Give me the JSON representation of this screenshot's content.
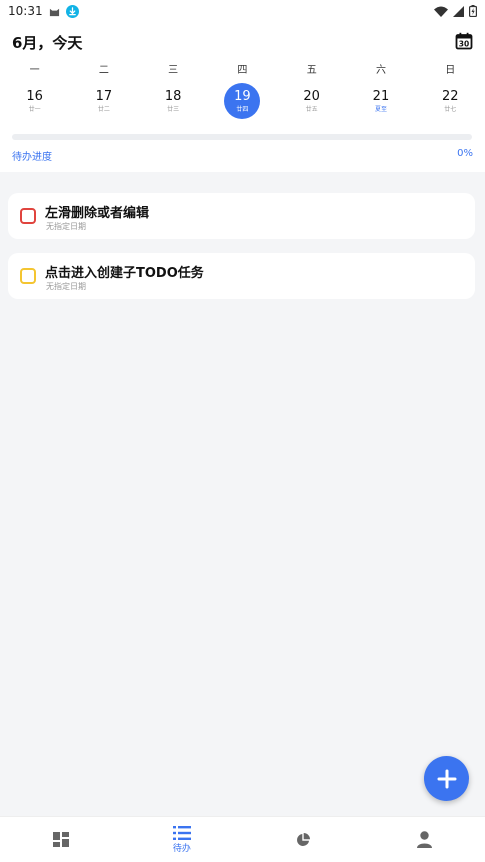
{
  "status_bar": {
    "time": "10:31"
  },
  "header": {
    "title": "6月，今天"
  },
  "calendar": {
    "days": [
      {
        "weekday": "一",
        "date": "16",
        "lunar": "廿一",
        "selected": false,
        "festival": false
      },
      {
        "weekday": "二",
        "date": "17",
        "lunar": "廿二",
        "selected": false,
        "festival": false
      },
      {
        "weekday": "三",
        "date": "18",
        "lunar": "廿三",
        "selected": false,
        "festival": false
      },
      {
        "weekday": "四",
        "date": "19",
        "lunar": "廿四",
        "selected": true,
        "festival": false
      },
      {
        "weekday": "五",
        "date": "20",
        "lunar": "廿五",
        "selected": false,
        "festival": false
      },
      {
        "weekday": "六",
        "date": "21",
        "lunar": "夏至",
        "selected": false,
        "festival": true
      },
      {
        "weekday": "日",
        "date": "22",
        "lunar": "廿七",
        "selected": false,
        "festival": false
      }
    ]
  },
  "progress": {
    "label": "待办进度",
    "value_text": "0%",
    "value": 0
  },
  "tasks": [
    {
      "title": "左滑删除或者编辑",
      "subtitle": "无指定日期",
      "checkbox_color": "#e0443e"
    },
    {
      "title": "点击进入创建子TODO任务",
      "subtitle": "无指定日期",
      "checkbox_color": "#f4c531"
    }
  ],
  "bottom_nav": {
    "items": [
      {
        "icon": "dashboard-icon",
        "label": "",
        "active": false
      },
      {
        "icon": "list-icon",
        "label": "待办",
        "active": true
      },
      {
        "icon": "pie-chart-icon",
        "label": "",
        "active": false
      },
      {
        "icon": "person-icon",
        "label": "",
        "active": false
      }
    ]
  },
  "colors": {
    "accent": "#3b74f0",
    "background": "#f4f5f7"
  }
}
